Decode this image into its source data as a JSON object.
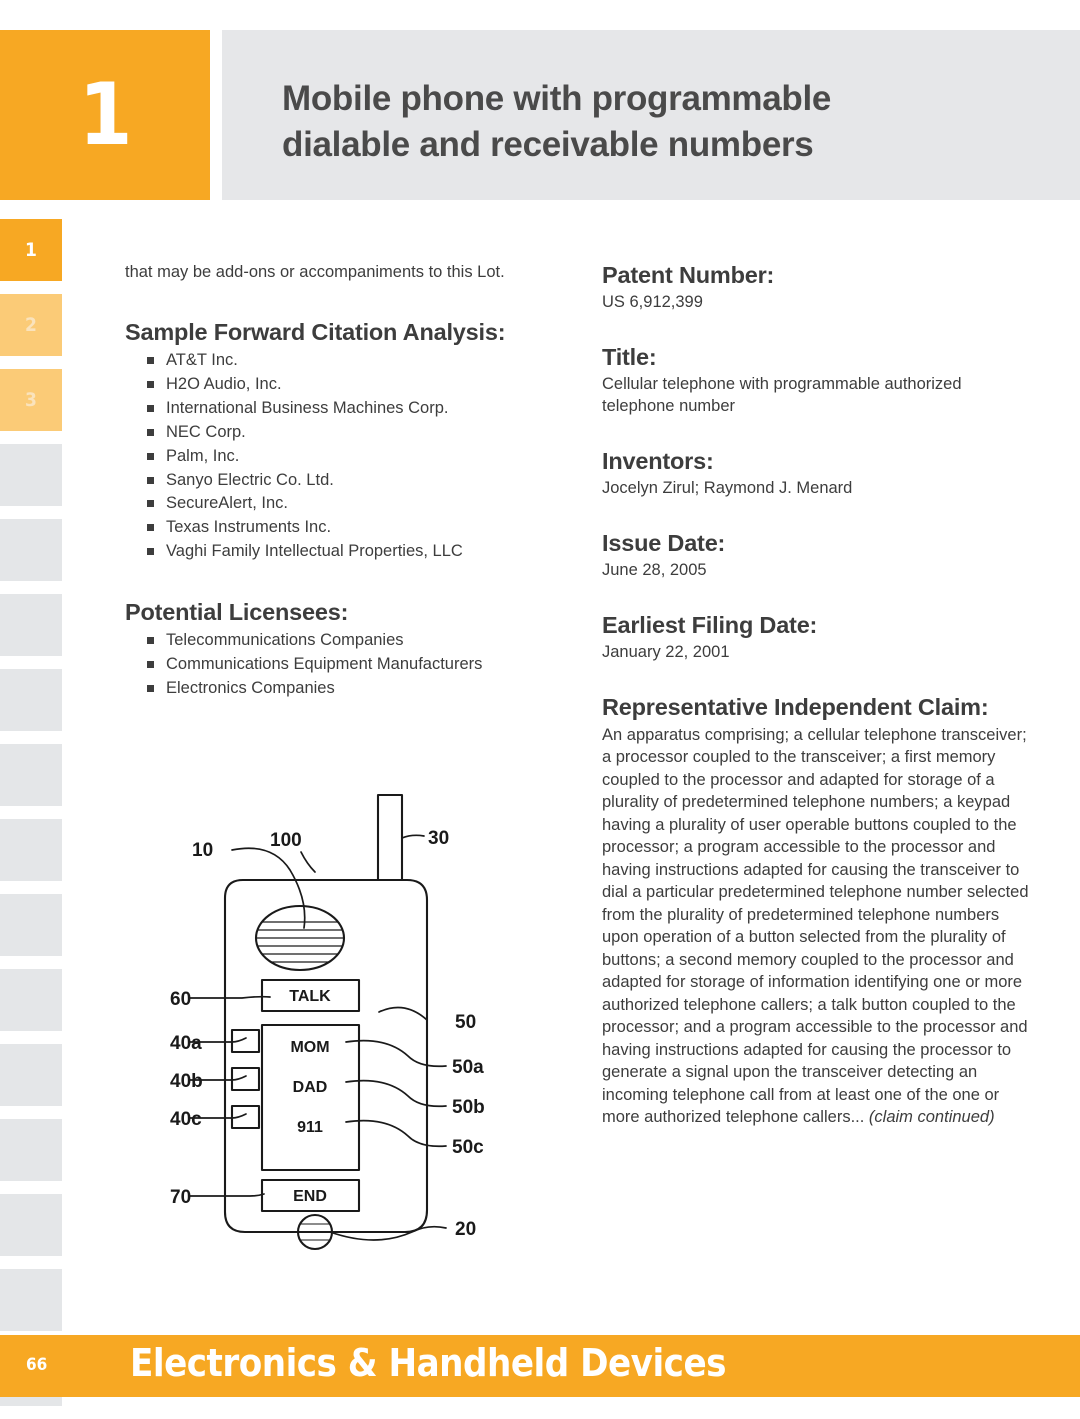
{
  "header": {
    "number": "1",
    "title_line1": "Mobile phone with programmable",
    "title_line2": "dialable and receivable numbers",
    "accent_color": "#F7A823",
    "panel_color": "#E6E7E9"
  },
  "tab_rail": {
    "tabs": [
      {
        "label": "1",
        "state": "active"
      },
      {
        "label": "2",
        "state": "light"
      },
      {
        "label": "3",
        "state": "light"
      },
      {
        "label": "",
        "state": "gray"
      },
      {
        "label": "",
        "state": "gray"
      },
      {
        "label": "",
        "state": "gray"
      },
      {
        "label": "",
        "state": "gray"
      },
      {
        "label": "",
        "state": "gray"
      },
      {
        "label": "",
        "state": "gray"
      },
      {
        "label": "",
        "state": "gray"
      },
      {
        "label": "",
        "state": "gray"
      },
      {
        "label": "",
        "state": "gray"
      },
      {
        "label": "",
        "state": "gray"
      },
      {
        "label": "",
        "state": "gray"
      },
      {
        "label": "",
        "state": "gray"
      },
      {
        "label": "",
        "state": "gray"
      }
    ]
  },
  "left_column": {
    "intro_paragraph": "that may be add-ons or accompaniments to this Lot.",
    "citation_heading": "Sample Forward Citation Analysis:",
    "citation_items": [
      "AT&T Inc.",
      "H2O Audio, Inc.",
      "International Business Machines Corp.",
      "NEC Corp.",
      "Palm, Inc.",
      "Sanyo Electric Co. Ltd.",
      "SecureAlert, Inc.",
      "Texas Instruments Inc.",
      "Vaghi Family Intellectual Properties, LLC"
    ],
    "licensees_heading": "Potential Licensees:",
    "licensees_items": [
      "Telecommunications Companies",
      "Communications Equipment Manufacturers",
      "Electronics Companies"
    ]
  },
  "right_column": {
    "patent_number_heading": "Patent Number:",
    "patent_number_value": "US 6,912,399",
    "title_heading": "Title:",
    "title_value": "Cellular telephone with programmable authorized telephone number",
    "inventors_heading": "Inventors:",
    "inventors_value": "Jocelyn Zirul; Raymond J. Menard",
    "issue_date_heading": "Issue Date:",
    "issue_date_value": "June 28, 2005",
    "earliest_filing_heading": "Earliest Filing Date:",
    "earliest_filing_value": "January 22, 2001",
    "claim_heading": "Representative Independent Claim:",
    "claim_body": "An apparatus comprising; a cellular telephone transceiver; a processor coupled to the transceiver; a first memory coupled to the processor and adapted for storage of a plurality of predetermined telephone numbers; a keypad having a plurality of user operable buttons coupled to the processor; a program accessible to the processor and having instructions adapted for causing the transceiver to dial a particular predetermined telephone number selected from the plurality of predetermined telephone numbers upon operation of a button selected from the plurality of buttons; a second memory coupled to the processor and adapted for storage of information identifying one or more authorized telephone callers; a talk button coupled to the processor; and a program accessible to the processor and having instructions adapted for causing the processor to generate a signal upon the transceiver detecting an incoming telephone call from at least one of the one or more authorized telephone callers...",
    "claim_continued": "(claim continued)"
  },
  "figure": {
    "alt": "Patent drawing of a mobile phone with labeled parts",
    "buttons": [
      "TALK",
      "MOM",
      "DAD",
      "911",
      "END"
    ],
    "reference_numbers": [
      "30",
      "10",
      "100",
      "60",
      "50",
      "40a",
      "40b",
      "40c",
      "50a",
      "50b",
      "50c",
      "70",
      "20"
    ]
  },
  "footer": {
    "page_number": "66",
    "section_title": "Electronics & Handheld Devices"
  }
}
